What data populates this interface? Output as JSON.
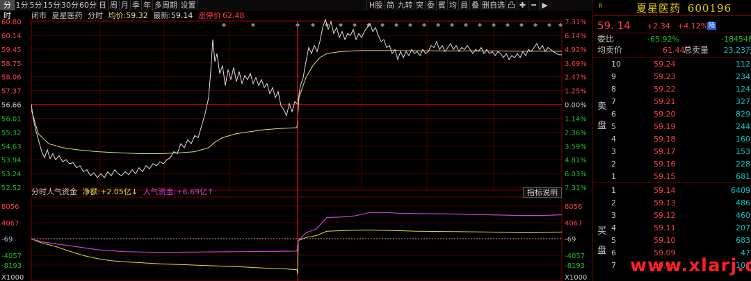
{
  "toolbar": {
    "periods": [
      "分时",
      "1分",
      "5分",
      "15分",
      "30分",
      "60分",
      "日",
      "周",
      "月",
      "季",
      "年",
      "多周期",
      "设置"
    ],
    "tools": [
      "H股",
      "简",
      "九转",
      "突",
      "委",
      "賓",
      "均",
      "員",
      "叠",
      "删自选",
      "凸",
      "✚",
      "━",
      "▶"
    ]
  },
  "main_info": {
    "status": "闭市",
    "name": "夏星医药",
    "mode": "分时",
    "avg_label": "均价:",
    "avg_value": "59.32",
    "latest_label": "最新:",
    "latest_value": "59.14",
    "limit_label": "涨停价",
    "limit_value": "62.48"
  },
  "price_axis": [
    "60.80",
    "60.14",
    "59.45",
    "58.75",
    "58.06",
    "57.37",
    "56.66",
    "56.01",
    "55.32",
    "54.63",
    "53.94",
    "53.24",
    "52.52"
  ],
  "pct_axis": [
    "7.31%",
    "6.14%",
    "4.92%",
    "3.69%",
    "2.47%",
    "1.25%",
    "0.00%",
    "1.14%",
    "2.36%",
    "3.59%",
    "4.81%",
    "6.03%",
    "7.31%"
  ],
  "sub_info": {
    "title": "分时人气资金",
    "net_label": "净额:",
    "net_value": "+2.05亿↓",
    "pop_label": "人气资金:",
    "pop_value": "+6.69亿↑",
    "indicator_button": "指标说明"
  },
  "sub_axis_left": [
    "8056",
    "4067",
    "-69",
    "-4057",
    "-8193",
    "X1000"
  ],
  "sub_axis_right": [
    "8056",
    "4067",
    "-69",
    "-4057",
    "-8193",
    "X1000"
  ],
  "quote": {
    "icon": "R",
    "name": "夏星医药",
    "code": "600196",
    "price": "59. 14",
    "change": "+2.34",
    "pct": "+4.12%",
    "tag": "陆",
    "weibi_label": "委比",
    "weibi_value": "-65.92%",
    "weicha_value": "-184548",
    "avg_label": "均卖价",
    "avg_value": "61.44",
    "total_label": "总卖量",
    "total_value": "23.23万",
    "sell_label": "卖\n盘",
    "buy_label": "买\n盘",
    "sell": [
      {
        "lvl": "10",
        "price": "59.24",
        "vol": "112"
      },
      {
        "lvl": "9",
        "price": "59.23",
        "vol": "234"
      },
      {
        "lvl": "8",
        "price": "59.22",
        "vol": "124"
      },
      {
        "lvl": "7",
        "price": "59.21",
        "vol": "327"
      },
      {
        "lvl": "6",
        "price": "59.20",
        "vol": "829"
      },
      {
        "lvl": "5",
        "price": "59.19",
        "vol": "244"
      },
      {
        "lvl": "4",
        "price": "59.18",
        "vol": "160"
      },
      {
        "lvl": "3",
        "price": "59.17",
        "vol": "153"
      },
      {
        "lvl": "2",
        "price": "59.16",
        "vol": "228"
      },
      {
        "lvl": "1",
        "price": "59.15",
        "vol": "681"
      }
    ],
    "buy": [
      {
        "lvl": "1",
        "price": "59.14",
        "vol": "6409"
      },
      {
        "lvl": "2",
        "price": "59.13",
        "vol": "486"
      },
      {
        "lvl": "3",
        "price": "59.12",
        "vol": "460"
      },
      {
        "lvl": "4",
        "price": "59.11",
        "vol": "207"
      },
      {
        "lvl": "5",
        "price": "59.10",
        "vol": "683"
      },
      {
        "lvl": "6",
        "price": "59.09",
        "vol": "47"
      },
      {
        "lvl": "7",
        "price": "59.08",
        "vol": "101"
      }
    ]
  },
  "watermark": "www.xlarj.com",
  "colors": {
    "price_line": "#e0e0e0",
    "avg_line": "#e0e080",
    "pop_line": "#d040d0",
    "net_line": "#e0e040",
    "grid": "#7a0000",
    "up": "#ff4040",
    "down": "#20c020"
  }
}
